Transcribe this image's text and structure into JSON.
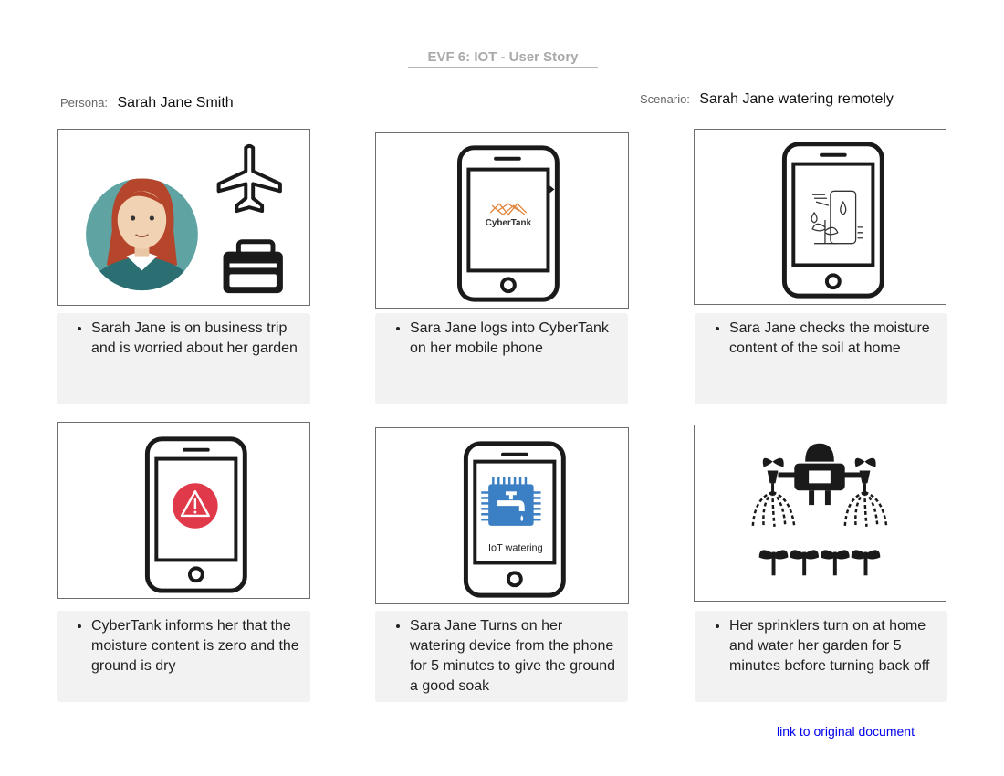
{
  "header": {
    "title": "EVF 6: IOT - User Story"
  },
  "persona": {
    "label": "Persona:",
    "name": "Sarah Jane Smith"
  },
  "scenario": {
    "label": "Scenario:",
    "name": "Sarah Jane watering remotely"
  },
  "panels": [
    {
      "caption": "Sarah Jane is on business trip and is worried about her garden"
    },
    {
      "caption": "Sara Jane logs into CyberTank on her mobile phone",
      "screen_text": "CyberTank"
    },
    {
      "caption": "Sara Jane checks the moisture content of the soil at home"
    },
    {
      "caption": "CyberTank informs her that the moisture content is zero and the ground is dry"
    },
    {
      "caption": "Sara Jane Turns on her watering device from the phone for 5 minutes to give the ground a good soak",
      "screen_text": "IoT watering"
    },
    {
      "caption": "Her sprinklers turn on at home and water her garden for 5 minutes before turning back off"
    }
  ],
  "footer": {
    "link_text": "link to original document"
  },
  "colors": {
    "alert_red": "#e0394a",
    "chip_blue": "#3b7fc4",
    "avatar_teal": "#5fa3a3",
    "hair": "#b5452b"
  }
}
